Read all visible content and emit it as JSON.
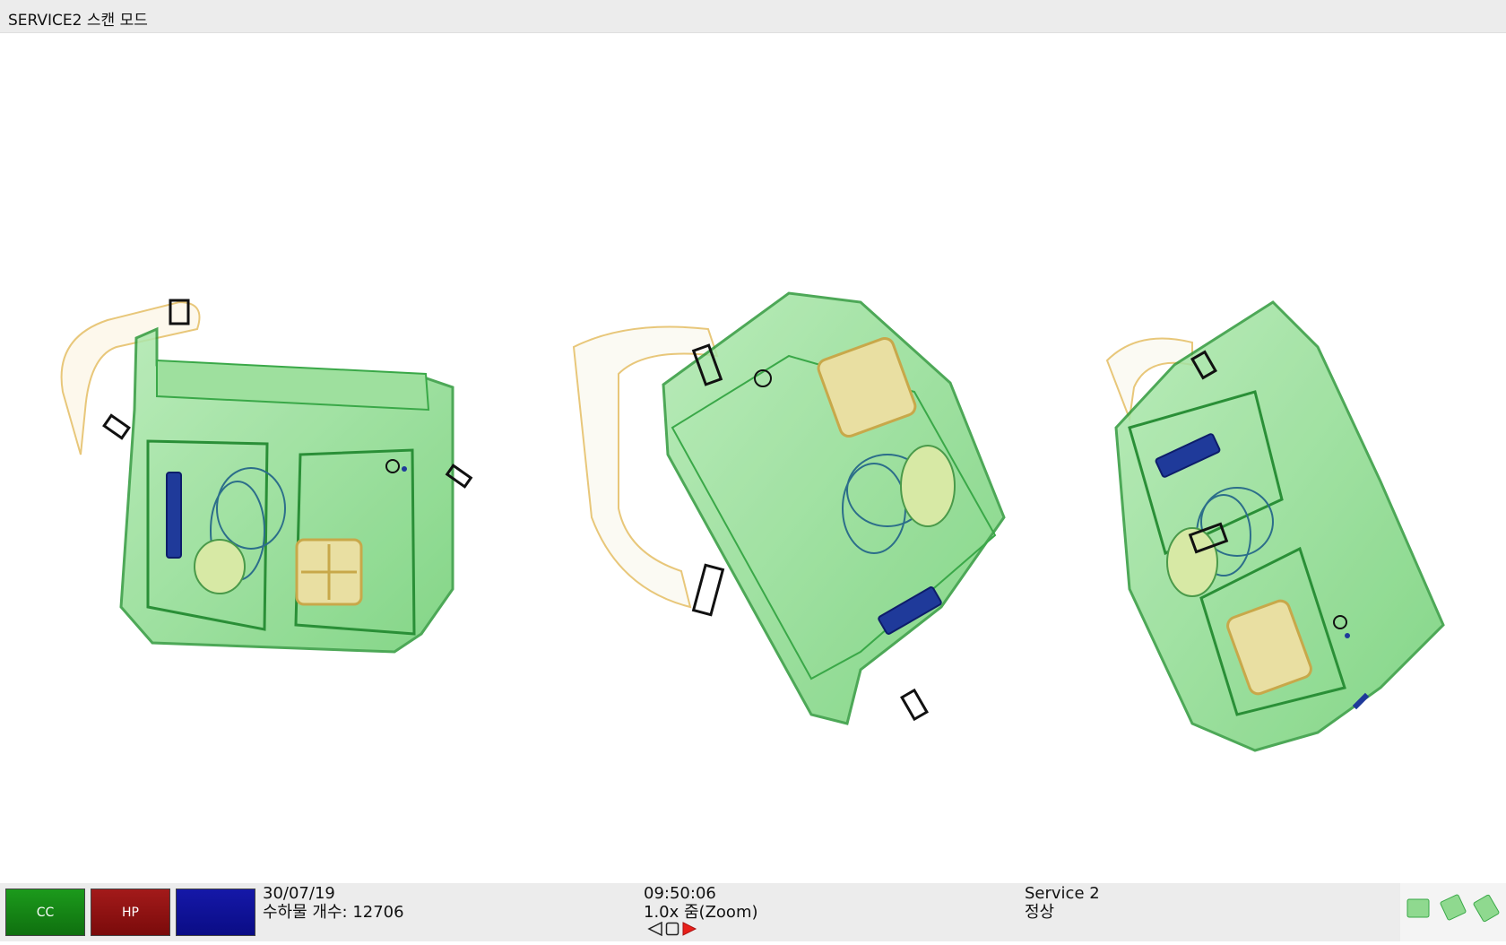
{
  "window": {
    "title": "SERVICE2 스캔 모드"
  },
  "function_buttons": [
    {
      "label": "CC",
      "color": "#148514"
    },
    {
      "label": "HP",
      "color": "#8e1212"
    },
    {
      "label": "",
      "color": "#0f11a0"
    }
  ],
  "status": {
    "date": "30/07/19",
    "bag_count_label": "수하물 개수:",
    "bag_count": "12706",
    "time": "09:50:06",
    "zoom": "1.0x 줌(Zoom)",
    "station": "Service 2",
    "state": "정상"
  },
  "navigation": {
    "prev_icon": "triangle-left-outline-icon",
    "stop_icon": "square-outline-icon",
    "next_icon": "triangle-right-red-icon"
  },
  "scan": {
    "items": [
      "bag-1",
      "bag-2",
      "bag-3"
    ],
    "colors": {
      "organic": "#7fd87f",
      "edge": "#2e9a3a",
      "metal": "#1a2a8a",
      "low_density": "#e8c15a"
    }
  }
}
